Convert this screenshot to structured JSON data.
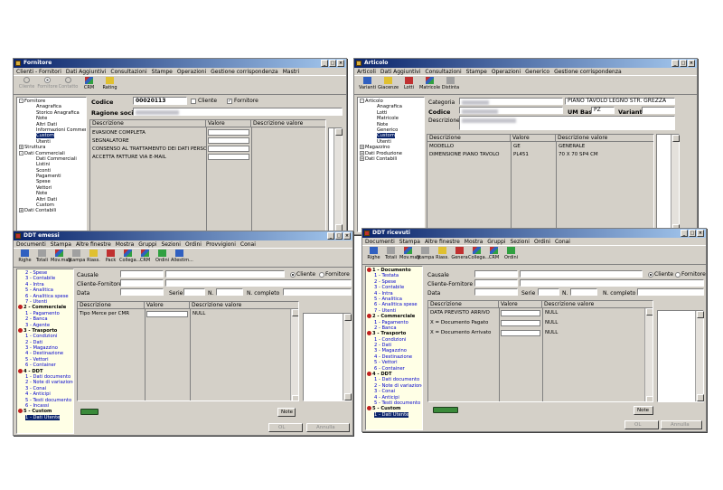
{
  "fornitore": {
    "title": "Fornitore",
    "menu": [
      "Clienti - Fornitori",
      "Dati Aggiuntivi",
      "Consultazioni",
      "Stampe",
      "Operazioni",
      "Gestione corrispondenza",
      "Mastri"
    ],
    "toolbar": [
      "Cliente",
      "Fornitore",
      "Contatto",
      "CRM",
      "Rating"
    ],
    "tree": [
      "Fornitore",
      "Anagrafica",
      "Storico Anagrafica",
      "Note",
      "Altri Dati",
      "Informazioni Commerciali",
      "Custom",
      "Utenti",
      "Struttura",
      "Dati Commerciali",
      "Dati Commerciali",
      "Listini",
      "Sconti",
      "Pagamenti",
      "Spese",
      "Vettori",
      "Note",
      "Altri Dati",
      "Custom",
      "Dati Contabili"
    ],
    "codice_label": "Codice",
    "codice_value": "00020113",
    "cliente_label": "Cliente",
    "fornitore_label": "Fornitore",
    "ragione_label": "Ragione sociale",
    "grid_headers": [
      "Descrizione",
      "Valore",
      "Descrizione valore"
    ],
    "rows": [
      "EVASIONE COMPLETA",
      "SEGNALATORE",
      "CONSENSO AL TRATTAMENTO DEI DATI PERSO",
      "ACCETTA FATTURE VIA E-MAIL"
    ]
  },
  "articolo": {
    "title": "Articolo",
    "menu": [
      "Articoli",
      "Dati Aggiuntivi",
      "Consultazioni",
      "Stampe",
      "Operazioni",
      "Generico",
      "Gestione corrispondenza"
    ],
    "toolbar": [
      "Varianti",
      "Giacenze",
      "Lotti",
      "Matricole",
      "Distinta"
    ],
    "tree": [
      "Articolo",
      "Anagrafica",
      "Lotti",
      "Matricole",
      "Note",
      "Generico",
      "Custom",
      "Utenti",
      "Magazzino",
      "Dati Produzione",
      "Dati Contabili"
    ],
    "categoria_label": "Categoria",
    "categoria_desc": "PIANO TAVOLO LEGNO STR. GREZZA",
    "codice_label": "Codice",
    "um_label": "UM Base",
    "um_value": "PZ",
    "varianti_label": "Varianti",
    "descrizione_label": "Descrizione",
    "grid_headers": [
      "Descrizione",
      "Valore",
      "Descrizione valore"
    ],
    "rows": [
      {
        "desc": "MODELLO",
        "val": "GE",
        "dv": "GENERALE"
      },
      {
        "desc": "DIMENSIONE PIANO TAVOLO",
        "val": "PL451",
        "dv": "70 X 70 SP4 CM"
      }
    ]
  },
  "ddt_emessi": {
    "title": "DDT emessi",
    "menu": [
      "Documenti",
      "Stampa",
      "Altre finestre",
      "Mostra",
      "Gruppi",
      "Sezioni",
      "Ordini",
      "Provvigioni",
      "Conai"
    ],
    "toolbar": [
      "Righe",
      "Totali",
      "Mov.mag.",
      "Stampa",
      "Riass.",
      "Pack",
      "Collega...",
      "CRM",
      "Ordini",
      "Allestim..."
    ],
    "tree": [
      {
        "t": "2 - Spese",
        "k": "sub"
      },
      {
        "t": "3 - Contabile",
        "k": "sub"
      },
      {
        "t": "4 - Intra",
        "k": "sub"
      },
      {
        "t": "5 - Analitica",
        "k": "sub"
      },
      {
        "t": "6 - Analitica spese",
        "k": "sub"
      },
      {
        "t": "7 - Utenti",
        "k": "sub"
      },
      {
        "t": "2 - Commerciale",
        "k": "sec"
      },
      {
        "t": "1 - Pagamento",
        "k": "sub"
      },
      {
        "t": "2 - Banca",
        "k": "sub"
      },
      {
        "t": "3 - Agente",
        "k": "sub"
      },
      {
        "t": "3 - Trasporto",
        "k": "sec"
      },
      {
        "t": "1 - Condizioni",
        "k": "sub"
      },
      {
        "t": "2 - Dati",
        "k": "sub"
      },
      {
        "t": "3 - Magazzino",
        "k": "sub"
      },
      {
        "t": "4 - Destinazione",
        "k": "sub"
      },
      {
        "t": "5 - Vettori",
        "k": "sub"
      },
      {
        "t": "6 - Container",
        "k": "sub"
      },
      {
        "t": "4 - DDT",
        "k": "sec"
      },
      {
        "t": "1 - Dati documento",
        "k": "sub"
      },
      {
        "t": "2 - Note di variazione",
        "k": "sub"
      },
      {
        "t": "3 - Conai",
        "k": "sub"
      },
      {
        "t": "4 - Anticipi",
        "k": "sub"
      },
      {
        "t": "5 - Testi documento",
        "k": "sub"
      },
      {
        "t": "6 - Incassi",
        "k": "sub"
      },
      {
        "t": "5 - Custom",
        "k": "sec"
      },
      {
        "t": "1 - Dati Utente",
        "k": "sel"
      }
    ],
    "causale_label": "Causale",
    "cliente_forn_label": "Cliente-Fornitore",
    "data_label": "Data",
    "serie_label": "Serie",
    "n_label": "N.",
    "ncompleto_label": "N. completo",
    "radio_cliente": "Cliente",
    "radio_fornitore": "Fornitore",
    "grid_headers": [
      "Descrizione",
      "Valore",
      "Descrizione valore"
    ],
    "rows": [
      {
        "desc": "Tipo Merce per CMR",
        "dv": "NULL"
      }
    ],
    "note_label": "Note",
    "ok_label": "OL",
    "annulla_label": "Annulla"
  },
  "ddt_ricevuti": {
    "title": "DDT ricevuti",
    "menu": [
      "Documenti",
      "Stampa",
      "Altre finestre",
      "Mostra",
      "Gruppi",
      "Sezioni",
      "Ordini",
      "Conai"
    ],
    "toolbar": [
      "Righe",
      "Totali",
      "Mov.mag.",
      "Stampa",
      "Riass.",
      "Genera",
      "Collega...",
      "CRM",
      "Ordini"
    ],
    "tree": [
      {
        "t": "1 - Documento",
        "k": "sec"
      },
      {
        "t": "1 - Testata",
        "k": "sub"
      },
      {
        "t": "2 - Spese",
        "k": "sub"
      },
      {
        "t": "3 - Contabile",
        "k": "sub"
      },
      {
        "t": "4 - Intra",
        "k": "sub"
      },
      {
        "t": "5 - Analitica",
        "k": "sub"
      },
      {
        "t": "6 - Analitica spese",
        "k": "sub"
      },
      {
        "t": "7 - Utenti",
        "k": "sub"
      },
      {
        "t": "2 - Commerciale",
        "k": "sec"
      },
      {
        "t": "1 - Pagamento",
        "k": "sub"
      },
      {
        "t": "2 - Banca",
        "k": "sub"
      },
      {
        "t": "3 - Trasporto",
        "k": "sec"
      },
      {
        "t": "1 - Condizioni",
        "k": "sub"
      },
      {
        "t": "2 - Dati",
        "k": "sub"
      },
      {
        "t": "3 - Magazzino",
        "k": "sub"
      },
      {
        "t": "4 - Destinazione",
        "k": "sub"
      },
      {
        "t": "5 - Vettori",
        "k": "sub"
      },
      {
        "t": "6 - Container",
        "k": "sub"
      },
      {
        "t": "4 - DDT",
        "k": "sec"
      },
      {
        "t": "1 - Dati documento",
        "k": "sub"
      },
      {
        "t": "2 - Note di variazione",
        "k": "sub"
      },
      {
        "t": "3 - Conai",
        "k": "sub"
      },
      {
        "t": "4 - Anticipi",
        "k": "sub"
      },
      {
        "t": "5 - Testi documento",
        "k": "sub"
      },
      {
        "t": "5 - Custom",
        "k": "sec"
      },
      {
        "t": "1 - Dati Utente",
        "k": "sel"
      }
    ],
    "causale_label": "Causale",
    "cliente_forn_label": "Cliente-Fornitore",
    "data_label": "Data",
    "serie_label": "Serie",
    "n_label": "N.",
    "ncompleto_label": "N. completo",
    "radio_cliente": "Cliente",
    "radio_fornitore": "Fornitore",
    "grid_headers": [
      "Descrizione",
      "Valore",
      "Descrizione valore"
    ],
    "rows": [
      {
        "desc": "DATA PREVISTO ARRIVO",
        "dv": "NULL"
      },
      {
        "desc": "X = Documento Pagato",
        "dv": "NULL"
      },
      {
        "desc": "X = Documento Arrivato",
        "dv": "NULL"
      }
    ],
    "note_label": "Note",
    "ok_label": "OL",
    "annulla_label": "Annulla"
  }
}
